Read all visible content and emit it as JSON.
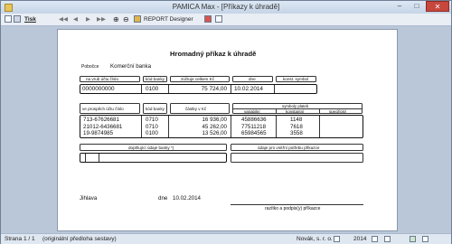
{
  "window": {
    "title": "PAMICA Max - [Příkazy k úhradě]",
    "min": "–",
    "max": "□",
    "close": "✕"
  },
  "toolbar": {
    "nav": [
      "◀◀",
      "◀",
      "▶",
      "▶▶"
    ],
    "zoom_in": "⊕",
    "zoom_out": "⊖",
    "print_label": "Tisk",
    "designer_label": "REPORT Designer"
  },
  "doc": {
    "title": "Hromadný příkaz k úhradě",
    "branch_label": "Pobočce",
    "branch_value": "Komerční banka",
    "top_headers": {
      "account": "na vrub účtu číslo",
      "bank_code": "kód banky",
      "total": "zúčtuje celkem Kč",
      "date": "dne",
      "const_symbol": "konst. symbol"
    },
    "top_row": {
      "account": "0000000000",
      "bank_code": "0100",
      "total": "75 724,00",
      "date": "10.02.2014",
      "const_symbol": ""
    },
    "items_headers": {
      "account": "ve prospěch účtu číslo",
      "bank_code": "kód banky",
      "amount": "částky v Kč",
      "symbols": "symboly plateb",
      "variable": "variabilní",
      "constant": "konstantní",
      "specific": "specifický"
    },
    "items": [
      {
        "account": "713-67626681",
        "bank_code": "0710",
        "amount": "16 936,00",
        "variable": "45886636",
        "constant": "1148",
        "specific": ""
      },
      {
        "account": "21012-6436681",
        "bank_code": "0710",
        "amount": "45 262,00",
        "variable": "77511218",
        "constant": "7618",
        "specific": ""
      },
      {
        "account": "19-9874985",
        "bank_code": "0100",
        "amount": "13 526,00",
        "variable": "65984565",
        "constant": "3558",
        "specific": ""
      }
    ],
    "bank_data_label": "doplňující údaje banky *)",
    "internal_label": "údaje pro vnitřní potřebu příkazce",
    "place": "Jihlava",
    "date_label": "dne",
    "date_value": "10.02.2014",
    "signature_label": "razítko a podpis(y) příkazce"
  },
  "status": {
    "page": "Strana 1 / 1",
    "template": "(originální předloha sestavy)",
    "company": "Novák, s. r. o.",
    "year": "2014"
  }
}
